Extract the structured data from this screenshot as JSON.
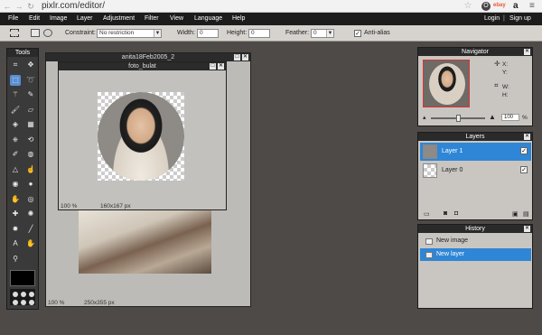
{
  "browser": {
    "url": "pixlr.com/editor/",
    "icons": [
      "back-arrow-icon",
      "forward-arrow-icon",
      "reload-icon",
      "star-icon",
      "ebay-icon",
      "amazon-icon",
      "menu-icon"
    ],
    "ebay": "ebay",
    "amazon": "a"
  },
  "menubar": {
    "items": [
      "File",
      "Edit",
      "Image",
      "Layer",
      "Adjustment",
      "Filter",
      "View",
      "Language",
      "Help"
    ],
    "login": "Login",
    "separator": "|",
    "signup": "Sign up"
  },
  "options": {
    "constraint_label": "Constraint:",
    "constraint_value": "No restriction",
    "width_label": "Width:",
    "width_value": "0",
    "height_label": "Height:",
    "height_value": "0",
    "feather_label": "Feather:",
    "feather_value": "0",
    "antialias_label": "Anti-alias",
    "antialias_checked": true
  },
  "tools": {
    "title": "Tools",
    "icons": [
      "crop-icon",
      "move-icon",
      "marquee-icon",
      "lasso-icon",
      "wand-icon",
      "pencil-icon",
      "brush-icon",
      "eraser-icon",
      "bucket-icon",
      "gradient-icon",
      "stamp-icon",
      "color-replace-icon",
      "drawing-icon",
      "blur-icon",
      "sharpen-icon",
      "smudge-icon",
      "sponge-icon",
      "dodge-icon",
      "burn-icon",
      "redeye-icon",
      "spotheal-icon",
      "bloat-icon",
      "pinch-icon",
      "eyedropper-icon",
      "type-icon",
      "hand-icon",
      "zoom-icon"
    ]
  },
  "doc_main": {
    "title": "anita18Feb2005_2",
    "zoom": "100",
    "zoom_unit": "%",
    "size": "250x355 px"
  },
  "doc_second": {
    "title": "foto_bulat",
    "zoom": "100",
    "zoom_unit": "%",
    "size": "160x167 px"
  },
  "navigator": {
    "title": "Navigator",
    "x_label": "X:",
    "y_label": "Y:",
    "w_label": "W:",
    "h_label": "H:",
    "zoom_value": "100",
    "zoom_unit": "%",
    "zoom_level": 0.5
  },
  "layers": {
    "title": "Layers",
    "items": [
      {
        "name": "Layer 1",
        "selected": true,
        "visible": true
      },
      {
        "name": "Layer 0",
        "selected": false,
        "visible": true
      }
    ]
  },
  "history": {
    "title": "History",
    "items": [
      {
        "name": "New image",
        "selected": false
      },
      {
        "name": "New layer",
        "selected": true
      }
    ]
  },
  "colors": {
    "accent": "#2f86d6",
    "menubar": "#1c1c1c",
    "workspace": "#4d4a47",
    "panel_bg": "#c9c6c1"
  }
}
